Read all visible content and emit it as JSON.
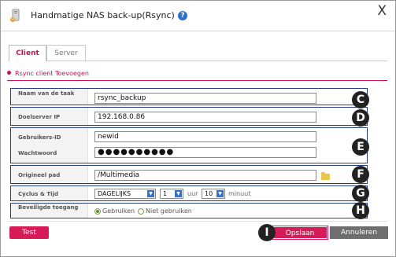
{
  "window": {
    "title": "Handmatige NAS back-up(Rsync)",
    "help_icon": "?",
    "close_label": "X"
  },
  "tabs": [
    {
      "label": "Client",
      "active": true
    },
    {
      "label": "Server",
      "active": false
    }
  ],
  "section": {
    "title": "Rsync client Toevoegen"
  },
  "form": {
    "task_name": {
      "label": "Naam van de taak",
      "value": "rsync_backup"
    },
    "target_server_ip": {
      "label": "Doelserver IP",
      "value": "192.168.0.86"
    },
    "user_id": {
      "label": "Gebruikers-ID",
      "value": "newid"
    },
    "password": {
      "label": "Wachtwoord",
      "value": "●●●●●●●●●●"
    },
    "source_path": {
      "label": "Origineel pad",
      "value": "/Multimedia"
    },
    "cycle_time": {
      "label": "Cyclus & Tijd",
      "cycle": "DAGELIJKS",
      "hour": "1",
      "hour_unit": "uur",
      "minute": "10",
      "minute_unit": "minuut"
    },
    "secure_access": {
      "label": "Beveiligde toegang",
      "options": [
        "Gebruiken",
        "Niet gebruiken"
      ],
      "selected": "Gebruiken"
    }
  },
  "callouts": [
    "C",
    "D",
    "E",
    "F",
    "G",
    "H",
    "I"
  ],
  "buttons": {
    "test": "Test",
    "save": "Opslaan",
    "cancel": "Annuleren"
  },
  "colors": {
    "accent": "#d61c58",
    "outline": "#2b3d8c",
    "cancel": "#6e6e6e"
  }
}
